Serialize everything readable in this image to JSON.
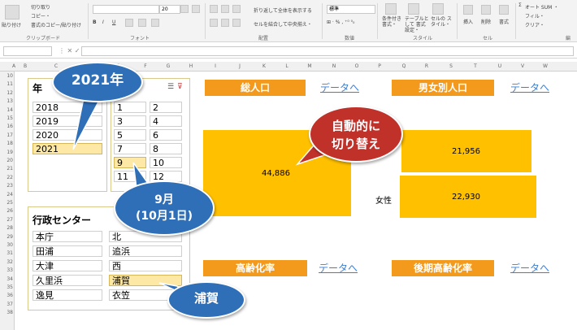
{
  "ribbon": {
    "clipboard": {
      "paste": "貼り付け",
      "cut": "切り取り",
      "copy": "コピー・",
      "format_painter": "書式のコピー/貼り付け",
      "group": "クリップボード"
    },
    "font": {
      "size": "20",
      "group": "フォント"
    },
    "alignment": {
      "wrap": "折り返して全体を表示する",
      "merge": "セルを結合して中央揃え・",
      "group": "配置"
    },
    "number": {
      "format": "標準",
      "group": "数値"
    },
    "styles": {
      "conditional": "条件付き 書式・",
      "table": "テーブルとして 書式設定・",
      "cell": "セルの スタイル・",
      "group": "スタイル"
    },
    "cells": {
      "insert": "挿入",
      "delete": "削除",
      "format": "書式",
      "group": "セル"
    },
    "editing": {
      "autosum": "オート SUM ・",
      "fill": "フィル・",
      "clear": "クリア・",
      "group": "編"
    }
  },
  "columns": [
    "A",
    "B",
    "C",
    "D",
    "E",
    "F",
    "G",
    "H",
    "I",
    "J",
    "K",
    "L",
    "M",
    "N",
    "O",
    "P",
    "Q",
    "R",
    "S",
    "T",
    "U",
    "V",
    "W"
  ],
  "rows": [
    "10",
    "11",
    "12",
    "13",
    "14",
    "15",
    "16",
    "17",
    "18",
    "19",
    "20",
    "21",
    "22",
    "23",
    "24",
    "25",
    "26",
    "27",
    "28",
    "29",
    "30",
    "31",
    "32",
    "33",
    "34",
    "35",
    "36",
    "37",
    "38"
  ],
  "year_slicer": {
    "title": "年",
    "items": [
      "2018",
      "2019",
      "2020",
      "2021"
    ],
    "selected": "2021"
  },
  "month_slicer": {
    "items": [
      "1",
      "2",
      "3",
      "4",
      "5",
      "6",
      "7",
      "8",
      "9",
      "10",
      "11",
      "12"
    ],
    "selected": "9"
  },
  "center_slicer": {
    "title": "行政センター",
    "items": [
      "本庁",
      "北",
      "田浦",
      "追浜",
      "大津",
      "西",
      "久里浜",
      "浦賀",
      "逸見",
      "衣笠"
    ],
    "selected": "浦賀"
  },
  "cards": {
    "total_pop": {
      "title": "総人口",
      "link": "データへ",
      "value": "44,886"
    },
    "gender_pop": {
      "title": "男女別人口",
      "link": "データへ",
      "male_value": "21,956",
      "female_label": "女性",
      "female_value": "22,930"
    },
    "aging_rate": {
      "title": "高齢化率",
      "link": "データへ"
    },
    "late_aging_rate": {
      "title": "後期高齢化率",
      "link": "データへ"
    }
  },
  "callouts": {
    "year": "2021年",
    "auto": [
      "自動的に",
      "切り替え"
    ],
    "month": [
      "9月",
      "(10月1日)"
    ],
    "center": "浦賀"
  },
  "colors": {
    "orange": "#f39a1c",
    "yellow": "#ffc000",
    "callout_blue": "#2f6fb8",
    "callout_red": "#c0312a",
    "link": "#3a7fd6",
    "selected": "#fde8a6"
  }
}
